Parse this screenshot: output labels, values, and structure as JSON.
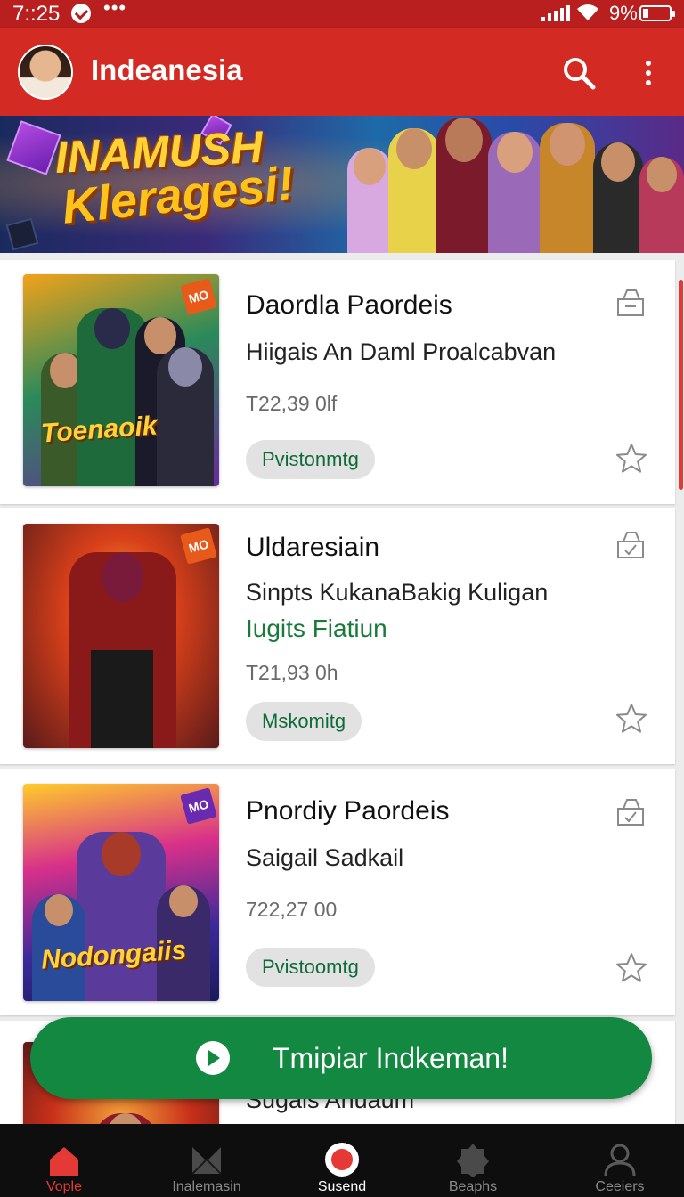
{
  "status_bar": {
    "time": "7::25",
    "battery": "9%"
  },
  "app_bar": {
    "title": "Indeanesia",
    "avatar_icon": "avatar",
    "search_icon": "search-icon",
    "menu_icon": "more-vert-icon"
  },
  "banner": {
    "line1": "INAMUSH",
    "line2": "Kleragesi!"
  },
  "cards": [
    {
      "title": "Daordla Paordeis",
      "subtitle": "Hiigais An Daml Proalcabvan",
      "green_text": "",
      "price": "T22,39 0lf",
      "chip": "Pvistonmtg",
      "thumb_title": "Toenaoik",
      "thumb_badge": "MO"
    },
    {
      "title": "Uldaresiain",
      "subtitle": "Sinpts KukanaBakig Kuligan",
      "green_text": "Iugits Fiatiun",
      "price": "T21,93 0h",
      "chip": "Mskomitg",
      "thumb_title": "",
      "thumb_badge": "MO"
    },
    {
      "title": "Pnordiy Paordeis",
      "subtitle": "Saigail Sadkail",
      "green_text": "",
      "price": "722,27 00",
      "chip": "Pvistoomtg",
      "thumb_title": "Nodongaiis",
      "thumb_badge": "MO"
    },
    {
      "title": "",
      "subtitle": "Sugais Anuaum",
      "green_text": "",
      "price": "",
      "chip": "",
      "thumb_title": "",
      "thumb_badge": ""
    }
  ],
  "fab": {
    "label": "Tmipiar Indkeman!"
  },
  "bottom_nav": [
    {
      "label": "Vople",
      "icon": "home-icon",
      "active": true
    },
    {
      "label": "Inalemasin",
      "icon": "envelope-icon",
      "active": false
    },
    {
      "label": "Susend",
      "icon": "record-icon",
      "active": false
    },
    {
      "label": "Beaphs",
      "icon": "badge-icon",
      "active": false
    },
    {
      "label": "Ceeiers",
      "icon": "profile-icon",
      "active": false
    }
  ],
  "colors": {
    "primary": "#d42a24",
    "status": "#b91f1f",
    "accent_green": "#128840",
    "chip_text": "#0e6a3a",
    "nav_active": "#e53935"
  }
}
